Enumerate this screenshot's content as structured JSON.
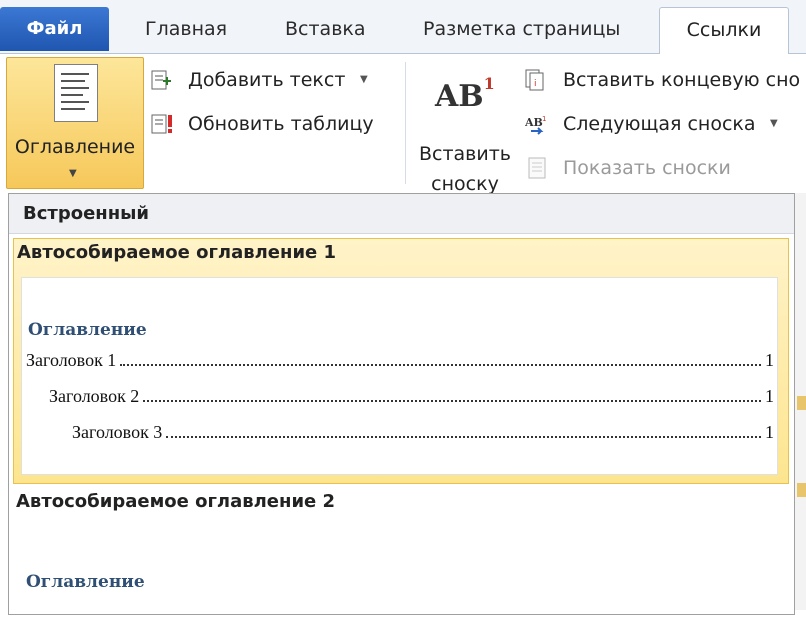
{
  "tabs": {
    "file": "Файл",
    "home": "Главная",
    "insert": "Вставка",
    "layout": "Разметка страницы",
    "references": "Ссылки"
  },
  "ribbon": {
    "toc_button": "Оглавление",
    "add_text": "Добавить текст",
    "update_table": "Обновить таблицу",
    "insert_footnote_icon": "AB",
    "insert_footnote_sup": "1",
    "insert_footnote_line1": "Вставить",
    "insert_footnote_line2": "сноску",
    "insert_endnote": "Вставить концевую сно",
    "next_footnote": "Следующая сноска",
    "show_notes": "Показать сноски"
  },
  "dropdown": {
    "section_header": "Встроенный",
    "items": [
      {
        "title": "Автособираемое оглавление 1",
        "toc_heading": "Оглавление",
        "lines": [
          {
            "text": "Заголовок 1",
            "page": "1"
          },
          {
            "text": "Заголовок 2",
            "page": "1"
          },
          {
            "text": "Заголовок 3",
            "page": "1"
          }
        ]
      },
      {
        "title": "Автособираемое оглавление 2",
        "toc_heading": "Оглавление"
      }
    ]
  },
  "colors": {
    "file_tab": "#2a64c2",
    "selection": "#fde58f",
    "toc_heading": "#2f4f74"
  }
}
